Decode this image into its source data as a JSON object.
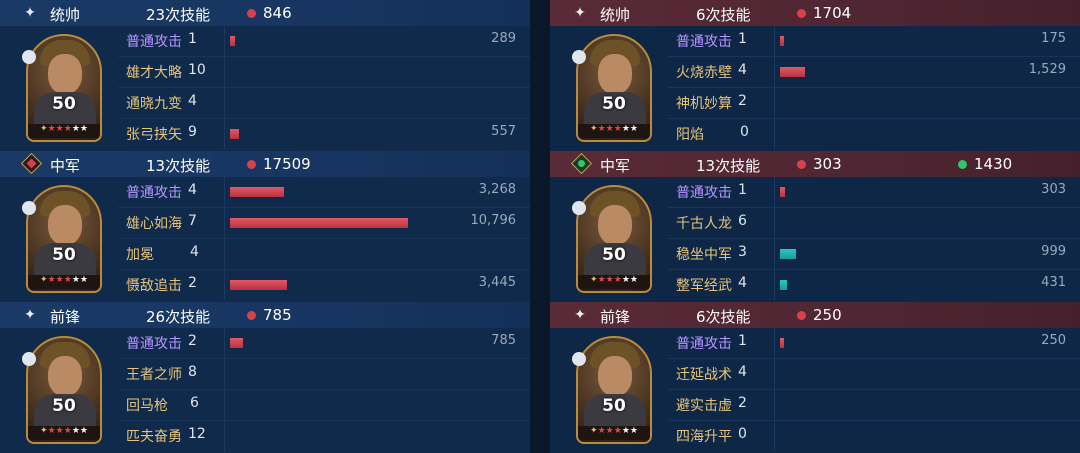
{
  "stars_glyph": "★",
  "lamp_glyph": "✦",
  "colors": {
    "left_header": "#173560",
    "right_header": "#4f2633",
    "red_bar": "#d8404b",
    "teal_bar": "#2cc7c2",
    "basic_skill": "#b596ff",
    "skill": "#e5c47a"
  },
  "left": {
    "groups": [
      {
        "role": "统帅",
        "role_icon": "sparkle-icon",
        "count": "23次技能",
        "stats": [
          {
            "value": "846",
            "color": "red"
          }
        ],
        "level": "50",
        "skills": [
          {
            "name": "普通攻击",
            "basic": true,
            "count": "1",
            "dmg": "289",
            "bar": 289,
            "color": "red"
          },
          {
            "name": "雄才大略",
            "basic": false,
            "count": "10",
            "dmg": "",
            "bar": 0,
            "color": "red"
          },
          {
            "name": "通晓九变",
            "basic": false,
            "count": "4",
            "dmg": "",
            "bar": 0,
            "color": "red"
          },
          {
            "name": "张弓挟矢",
            "basic": false,
            "count": "9",
            "dmg": "557",
            "bar": 557,
            "color": "red"
          }
        ]
      },
      {
        "role": "中军",
        "role_icon": "diamond-red-icon",
        "count": "13次技能",
        "stats": [
          {
            "value": "17509",
            "color": "red"
          }
        ],
        "level": "50",
        "skills": [
          {
            "name": "普通攻击",
            "basic": true,
            "count": "4",
            "dmg": "3,268",
            "bar": 3268,
            "color": "red"
          },
          {
            "name": "雄心如海",
            "basic": false,
            "count": "7",
            "dmg": "10,796",
            "bar": 10796,
            "color": "red"
          },
          {
            "name": "加冕",
            "basic": false,
            "count": "4",
            "dmg": "",
            "bar": 0,
            "color": "red"
          },
          {
            "name": "慑敌追击",
            "basic": false,
            "count": "2",
            "dmg": "3,445",
            "bar": 3445,
            "color": "red"
          }
        ]
      },
      {
        "role": "前锋",
        "role_icon": "sparkle-icon",
        "count": "26次技能",
        "stats": [
          {
            "value": "785",
            "color": "red"
          }
        ],
        "level": "50",
        "skills": [
          {
            "name": "普通攻击",
            "basic": true,
            "count": "2",
            "dmg": "785",
            "bar": 785,
            "color": "red"
          },
          {
            "name": "王者之师",
            "basic": false,
            "count": "8",
            "dmg": "",
            "bar": 0,
            "color": "red"
          },
          {
            "name": "回马枪",
            "basic": false,
            "count": "6",
            "dmg": "",
            "bar": 0,
            "color": "red"
          },
          {
            "name": "匹夫奋勇",
            "basic": false,
            "count": "12",
            "dmg": "",
            "bar": 0,
            "color": "red"
          }
        ]
      }
    ]
  },
  "right": {
    "groups": [
      {
        "role": "统帅",
        "role_icon": "sparkle-icon",
        "count": "6次技能",
        "stats": [
          {
            "value": "1704",
            "color": "red"
          }
        ],
        "level": "50",
        "skills": [
          {
            "name": "普通攻击",
            "basic": true,
            "count": "1",
            "dmg": "175",
            "bar": 175,
            "color": "red"
          },
          {
            "name": "火烧赤壁",
            "basic": false,
            "count": "4",
            "dmg": "1,529",
            "bar": 1529,
            "color": "red"
          },
          {
            "name": "神机妙算",
            "basic": false,
            "count": "2",
            "dmg": "",
            "bar": 0,
            "color": "red"
          },
          {
            "name": "阳焰",
            "basic": false,
            "count": "0",
            "dmg": "",
            "bar": 0,
            "color": "red"
          }
        ]
      },
      {
        "role": "中军",
        "role_icon": "diamond-green-icon",
        "count": "13次技能",
        "stats": [
          {
            "value": "303",
            "color": "red"
          },
          {
            "value": "1430",
            "color": "green"
          }
        ],
        "level": "50",
        "skills": [
          {
            "name": "普通攻击",
            "basic": true,
            "count": "1",
            "dmg": "303",
            "bar": 303,
            "color": "red"
          },
          {
            "name": "千古人龙",
            "basic": false,
            "count": "6",
            "dmg": "",
            "bar": 0,
            "color": "red"
          },
          {
            "name": "稳坐中军",
            "basic": false,
            "count": "3",
            "dmg": "999",
            "bar": 999,
            "color": "teal"
          },
          {
            "name": "整军经武",
            "basic": false,
            "count": "4",
            "dmg": "431",
            "bar": 431,
            "color": "teal"
          }
        ]
      },
      {
        "role": "前锋",
        "role_icon": "sparkle-icon",
        "count": "6次技能",
        "stats": [
          {
            "value": "250",
            "color": "red"
          }
        ],
        "level": "50",
        "skills": [
          {
            "name": "普通攻击",
            "basic": true,
            "count": "1",
            "dmg": "250",
            "bar": 250,
            "color": "red"
          },
          {
            "name": "迁延战术",
            "basic": false,
            "count": "4",
            "dmg": "",
            "bar": 0,
            "color": "red"
          },
          {
            "name": "避实击虚",
            "basic": false,
            "count": "2",
            "dmg": "",
            "bar": 0,
            "color": "red"
          },
          {
            "name": "四海升平",
            "basic": false,
            "count": "0",
            "dmg": "",
            "bar": 0,
            "color": "red"
          }
        ]
      }
    ]
  }
}
